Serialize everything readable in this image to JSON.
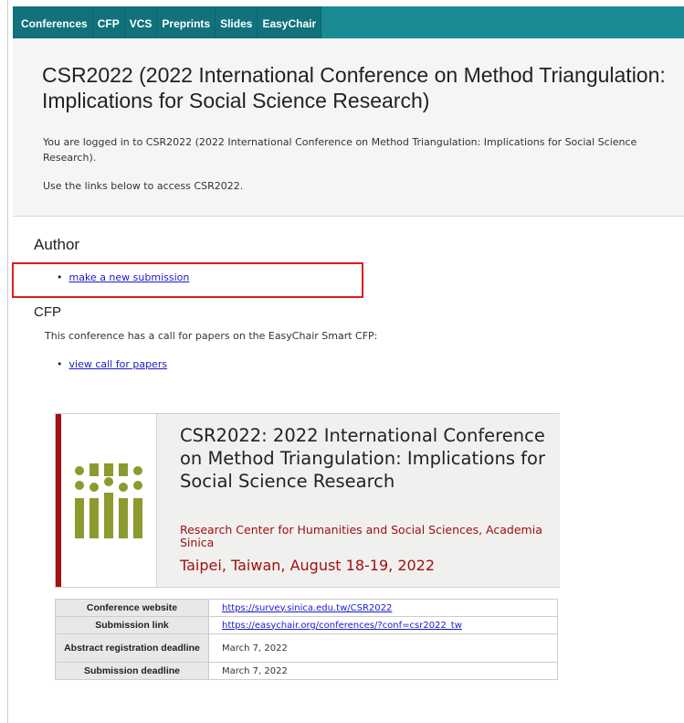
{
  "nav": [
    "Conferences",
    "CFP",
    "VCS",
    "Preprints",
    "Slides",
    "EasyChair"
  ],
  "header": {
    "title": "CSR2022 (2022 International Conference on Method Triangulation: Implications for Social Science Research)",
    "login_message": "You are logged in to CSR2022 (2022 International Conference on Method Triangulation: Implications for Social Science Research).",
    "use_links": "Use the links below to access CSR2022."
  },
  "author": {
    "heading": "Author",
    "new_submission": "make a new submission"
  },
  "cfp": {
    "heading": "CFP",
    "text": "This conference has a call for papers on the EasyChair Smart CFP:",
    "view_link": "view call for papers"
  },
  "banner": {
    "title": "CSR2022: 2022 International Conference on Method Triangulation: Implications for Social Science Research",
    "organization": "Research Center for Humanities and Social Sciences, Academia Sinica",
    "location": "Taipei, Taiwan, August 18-19, 2022"
  },
  "info_table": {
    "rows": [
      {
        "label": "Conference website",
        "value": "https://survey.sinica.edu.tw/CSR2022"
      },
      {
        "label": "Submission link",
        "value": "https://easychair.org/conferences/?conf=csr2022_tw"
      },
      {
        "label": "Abstract registration deadline",
        "value": "March 7, 2022"
      },
      {
        "label": "Submission deadline",
        "value": "March 7, 2022"
      }
    ]
  },
  "colors": {
    "nav_bg": "#1a8a94",
    "accent_red": "#a31010",
    "logo_olive": "#8c9a2e",
    "link": "#1a1acc"
  }
}
